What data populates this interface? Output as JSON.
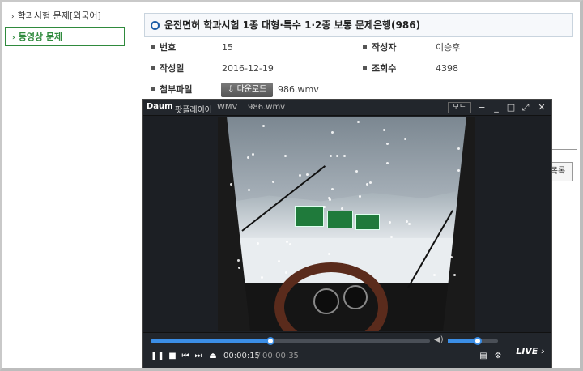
{
  "sidebar": {
    "items": [
      {
        "label": "학과시험 문제[외국어]"
      },
      {
        "label": "동영상 문제"
      }
    ]
  },
  "content": {
    "title": "운전면허 학과시험 1종 대형·특수 1·2종 보통 문제은행(986)",
    "fields": {
      "no_label": "번호",
      "no_value": "15",
      "author_label": "작성자",
      "author_value": "이승후",
      "date_label": "작성일",
      "date_value": "2016-12-19",
      "views_label": "조회수",
      "views_value": "4398",
      "attach_label": "첨부파일",
      "download_label": "다운로드",
      "file_name": "986.wmv"
    },
    "right_button": "목록"
  },
  "player": {
    "logo": "Daum",
    "name": "팟플레이어",
    "format": "WMV",
    "file": "986.wmv",
    "mode": "모드",
    "time_current": "00:00:15",
    "time_sep": "/",
    "time_total": "00:00:35",
    "progress": 0.43,
    "volume": 0.6,
    "live": "LIVE",
    "accent": "#3b8ee6"
  }
}
